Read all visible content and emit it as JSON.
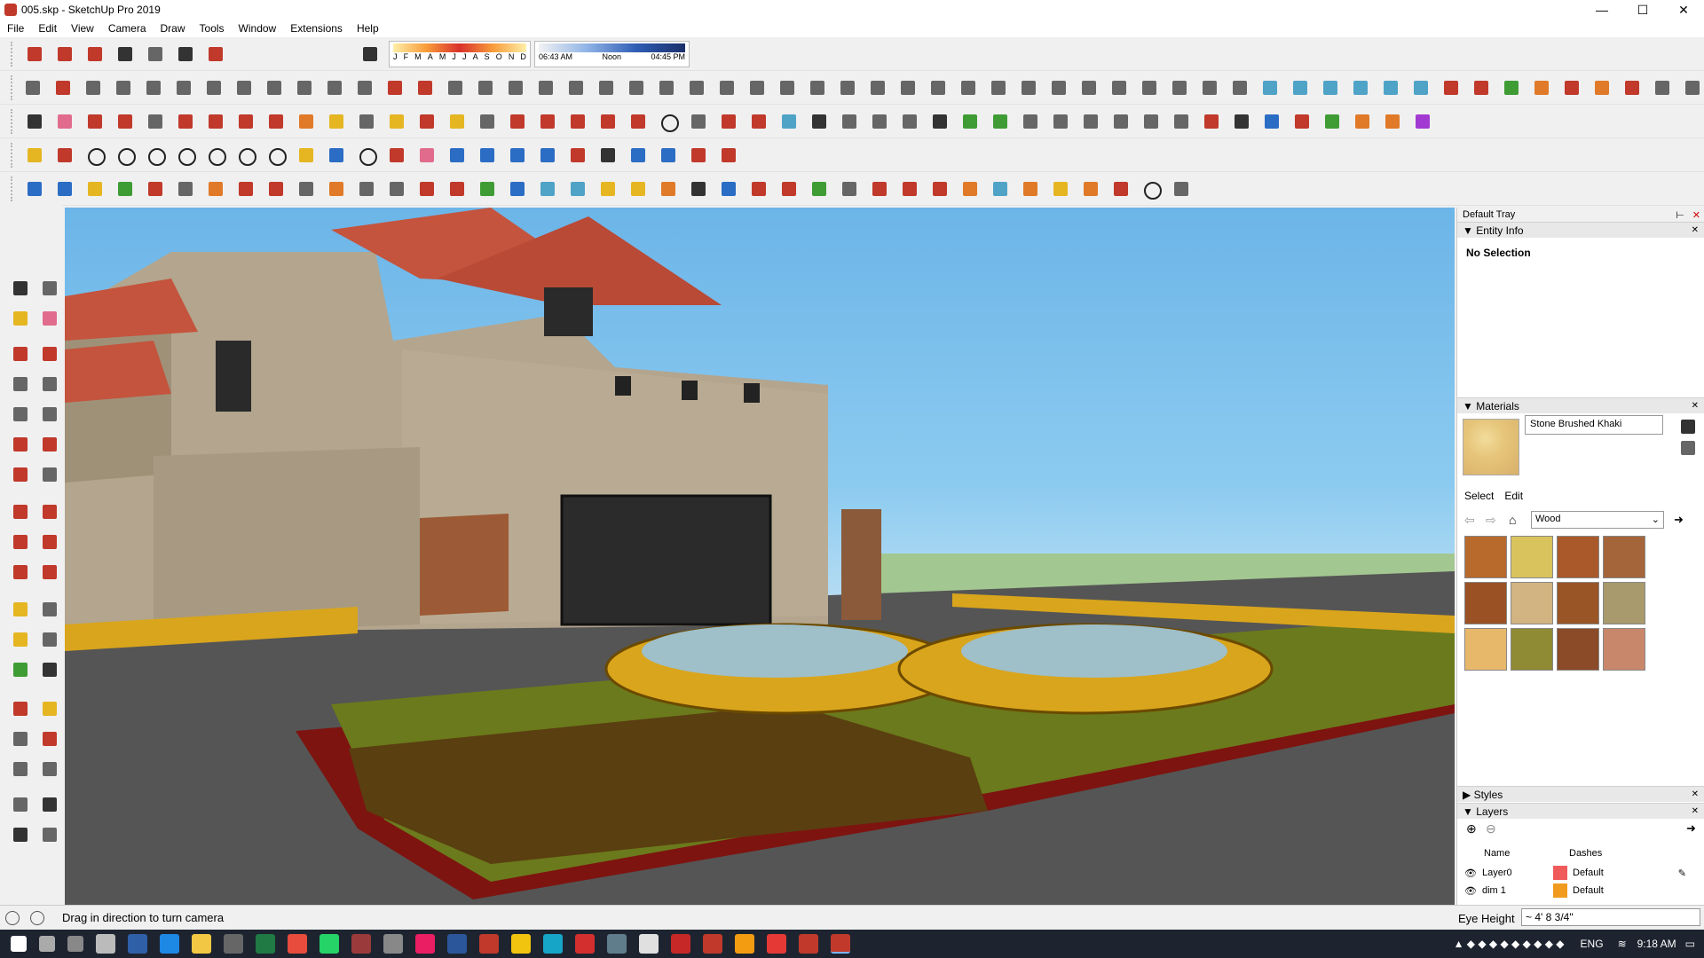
{
  "window": {
    "title": "005.skp - SketchUp Pro 2019",
    "controls": [
      "—",
      "☐",
      "✕"
    ]
  },
  "menu": [
    "File",
    "Edit",
    "View",
    "Camera",
    "Draw",
    "Tools",
    "Window",
    "Extensions",
    "Help"
  ],
  "shadows": {
    "months": [
      "J",
      "F",
      "M",
      "A",
      "M",
      "J",
      "J",
      "A",
      "S",
      "O",
      "N",
      "D"
    ],
    "time_start": "06:43 AM",
    "time_mid": "Noon",
    "time_end": "04:45 PM"
  },
  "viewport": {
    "sky_color": "#7dbde9"
  },
  "tray": {
    "title": "Default Tray",
    "entity_info": {
      "header": "Entity Info",
      "selection": "No Selection"
    },
    "materials": {
      "header": "Materials",
      "current_name": "Stone Brushed Khaki",
      "tab_select": "Select",
      "tab_edit": "Edit",
      "library": "Wood",
      "swatch_colors": [
        "#b8692c",
        "#d9c35d",
        "#a9592a",
        "#a5653a",
        "#9a5124",
        "#d2b482",
        "#9a5527",
        "#a89a6d",
        "#e8b86a",
        "#8f8a34",
        "#8b4a28",
        "#c8876a"
      ]
    },
    "styles": {
      "header": "Styles"
    },
    "layers": {
      "header": "Layers",
      "col_name": "Name",
      "col_dashes": "Dashes",
      "rows": [
        {
          "name": "Layer0",
          "dashes": "Default",
          "color": "#ef5a5a"
        },
        {
          "name": "dim 1",
          "dashes": "Default",
          "color": "#f09a1e"
        }
      ]
    }
  },
  "status": {
    "message": "Drag in direction to turn camera",
    "measure_label": "Eye Height",
    "measure_value": "~ 4' 8 3/4\""
  },
  "taskbar": {
    "lang": "ENG",
    "time": "9:18 AM"
  }
}
